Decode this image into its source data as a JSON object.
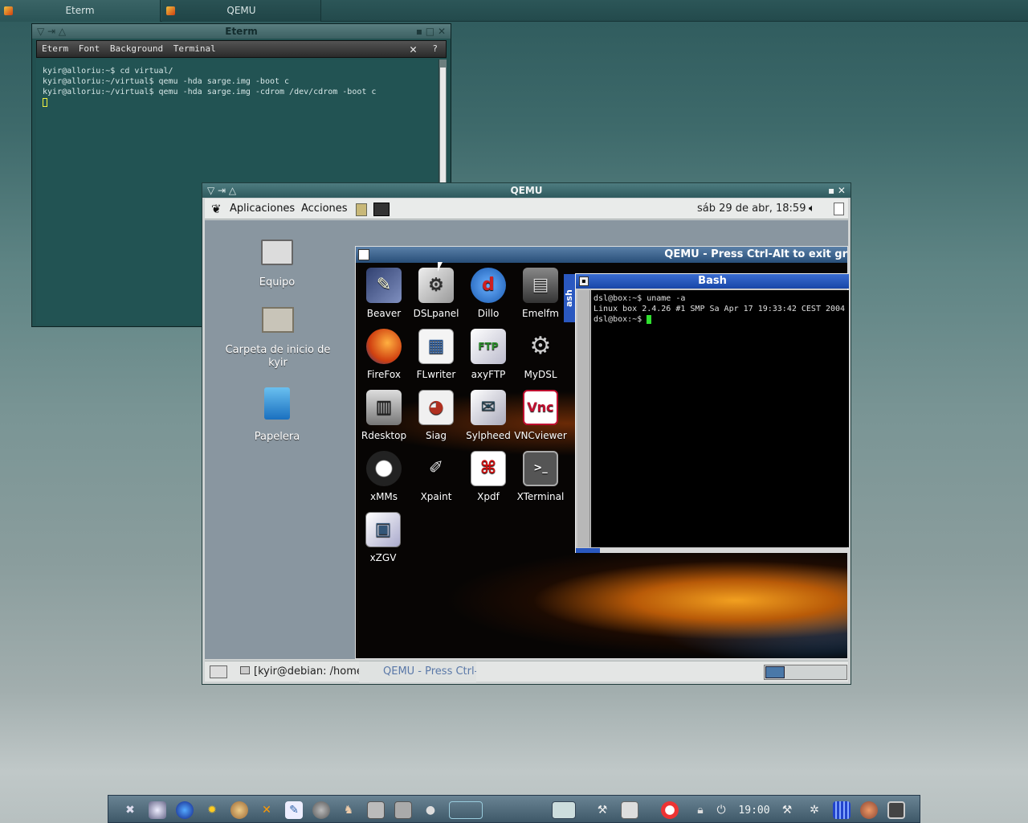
{
  "taskbar_top": {
    "tabs": [
      {
        "label": "Eterm"
      },
      {
        "label": "QEMU"
      }
    ]
  },
  "eterm": {
    "title": "Eterm",
    "menu": [
      "Eterm",
      "Font",
      "Background",
      "Terminal"
    ],
    "lines": [
      "kyir@alloriu:~$ cd virtual/",
      "kyir@alloriu:~/virtual$ qemu -hda sarge.img -boot c",
      "kyir@alloriu:~/virtual$ qemu -hda sarge.img -cdrom /dev/cdrom -boot c"
    ]
  },
  "qemu": {
    "title": "QEMU",
    "panel": {
      "apps": "Aplicaciones",
      "actions": "Acciones",
      "clock": "sáb 29 de abr, 18:59"
    },
    "desktop_icons": [
      {
        "label": "Equipo"
      },
      {
        "label": "Carpeta de inicio de kyir"
      },
      {
        "label": "Papelera"
      }
    ],
    "bottom": {
      "task1": "[kyir@debian: /home/kyir]",
      "task2": "QEMU - Press Ctrl-A"
    }
  },
  "inner": {
    "title": "QEMU - Press Ctrl-Alt to exit gr",
    "side_label": "ash",
    "apps": [
      {
        "label": "Beaver",
        "icon": "beaver-icon"
      },
      {
        "label": "DSLpanel",
        "icon": "dslpanel-icon"
      },
      {
        "label": "Dillo",
        "icon": "dillo-icon"
      },
      {
        "label": "Emelfm",
        "icon": "emelfm-icon"
      },
      {
        "label": "FireFox",
        "icon": "firefox-icon"
      },
      {
        "label": "FLwriter",
        "icon": "flwriter-icon"
      },
      {
        "label": "axyFTP",
        "icon": "axyftp-icon"
      },
      {
        "label": "MyDSL",
        "icon": "mydsl-icon"
      },
      {
        "label": "Rdesktop",
        "icon": "rdesktop-icon"
      },
      {
        "label": "Siag",
        "icon": "siag-icon"
      },
      {
        "label": "Sylpheed",
        "icon": "sylpheed-icon"
      },
      {
        "label": "VNCviewer",
        "icon": "vncviewer-icon"
      },
      {
        "label": "xMMs",
        "icon": "xmms-icon"
      },
      {
        "label": "Xpaint",
        "icon": "xpaint-icon"
      },
      {
        "label": "Xpdf",
        "icon": "xpdf-icon"
      },
      {
        "label": "XTerminal",
        "icon": "xterminal-icon"
      },
      {
        "label": "xZGV",
        "icon": "xzgv-icon"
      }
    ]
  },
  "bash": {
    "title": "Bash",
    "lines": [
      "dsl@box:~$ uname -a",
      "Linux box 2.4.26 #1 SMP Sa Apr 17 19:33:42 CEST 2004",
      "dsl@box:~$ "
    ]
  },
  "dock": {
    "clock": "19:00"
  }
}
